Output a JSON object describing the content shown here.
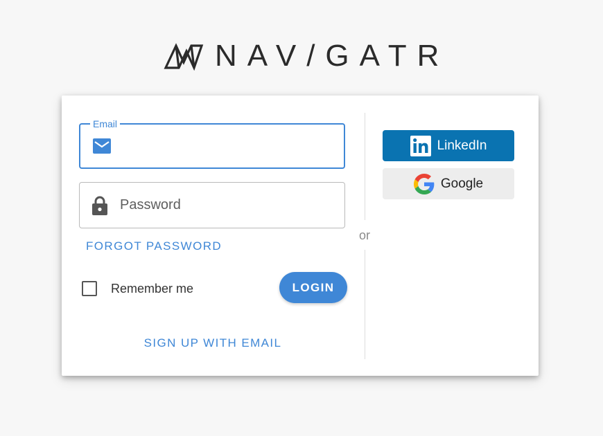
{
  "brand": {
    "name": "NAV/GATR"
  },
  "login_form": {
    "email": {
      "legend": "Email",
      "value": "",
      "icon": "email-icon"
    },
    "password": {
      "placeholder": "Password",
      "value": "",
      "icon": "lock-icon"
    },
    "forgot_password_label": "FORGOT PASSWORD",
    "remember_me_label": "Remember me",
    "remember_me_checked": false,
    "login_label": "LOGIN",
    "signup_label": "SIGN UP WITH EMAIL"
  },
  "divider_label": "or",
  "social": {
    "linkedin_label": "LinkedIn",
    "google_label": "Google"
  },
  "colors": {
    "accent": "#3f87d6",
    "linkedin": "#0a73b1",
    "google_button_bg": "#ededed",
    "page_background": "#f7f7f7"
  }
}
